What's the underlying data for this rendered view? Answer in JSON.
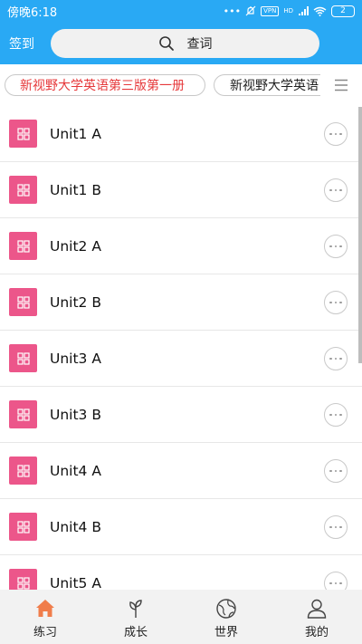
{
  "status_bar": {
    "time": "傍晚6:18",
    "vpn": "VPN",
    "network": "HD",
    "battery": "2"
  },
  "header": {
    "signin_label": "签到",
    "search_label": "查词"
  },
  "book_tabs": [
    "新视野大学英语第三版第一册",
    "新视野大学英语"
  ],
  "units": [
    "Unit1 A",
    "Unit1 B",
    "Unit2 A",
    "Unit2 B",
    "Unit3 A",
    "Unit3 B",
    "Unit4 A",
    "Unit4 B",
    "Unit5 A"
  ],
  "bottom_nav": [
    {
      "label": "练习",
      "icon": "home-icon",
      "active": true
    },
    {
      "label": "成长",
      "icon": "sprout-icon",
      "active": false
    },
    {
      "label": "世界",
      "icon": "globe-icon",
      "active": false
    },
    {
      "label": "我的",
      "icon": "person-icon",
      "active": false
    }
  ],
  "colors": {
    "header": "#29a9f4",
    "active_tab": "#e6393b",
    "unit_icon": "#ec568a",
    "nav_active": "#f07d4b"
  }
}
